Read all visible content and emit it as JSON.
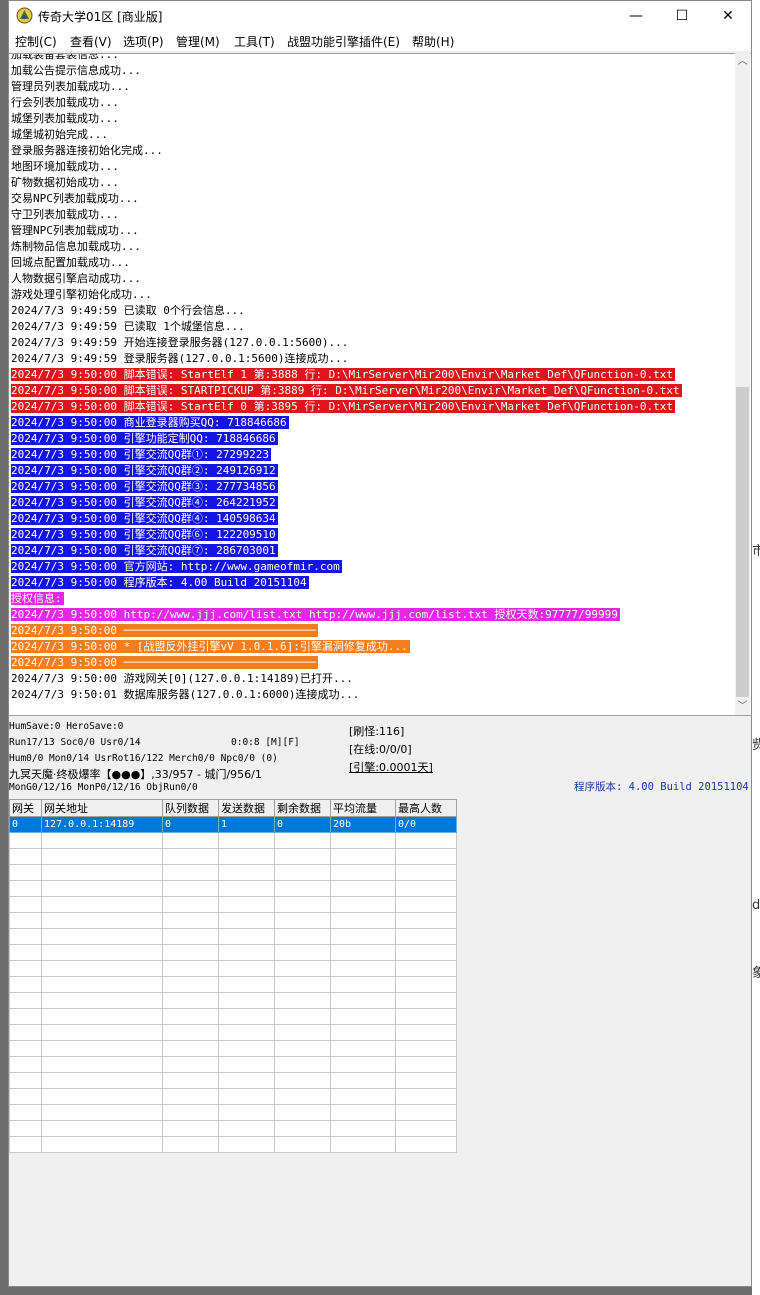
{
  "window": {
    "title": "传奇大学01区 [商业版]",
    "minimize": "—",
    "maximize": "☐",
    "close": "✕"
  },
  "menu": [
    "控制(C)",
    "查看(V)",
    "选项(P)",
    "管理(M)",
    "工具(T)",
    "战盟功能引擎插件(E)",
    "帮助(H)"
  ],
  "background_fragments": [
    "市",
    "赀",
    "d",
    "象"
  ],
  "log": [
    {
      "text": "加载装备套装信息...",
      "style": "plain"
    },
    {
      "text": "加载公告提示信息成功...",
      "style": "plain"
    },
    {
      "text": "管理员列表加载成功...",
      "style": "plain"
    },
    {
      "text": "行会列表加载成功...",
      "style": "plain"
    },
    {
      "text": "城堡列表加载成功...",
      "style": "plain"
    },
    {
      "text": "城堡城初始完成...",
      "style": "plain"
    },
    {
      "text": "登录服务器连接初始化完成...",
      "style": "plain"
    },
    {
      "text": "地图环境加载成功...",
      "style": "plain"
    },
    {
      "text": "矿物数据初始成功...",
      "style": "plain"
    },
    {
      "text": "交易NPC列表加载成功...",
      "style": "plain"
    },
    {
      "text": "守卫列表加载成功...",
      "style": "plain"
    },
    {
      "text": "管理NPC列表加载成功...",
      "style": "plain"
    },
    {
      "text": "炼制物品信息加载成功...",
      "style": "plain"
    },
    {
      "text": "回城点配置加载成功...",
      "style": "plain"
    },
    {
      "text": "人物数据引擎启动成功...",
      "style": "plain"
    },
    {
      "text": "游戏处理引擎初始化成功...",
      "style": "plain"
    },
    {
      "text": "2024/7/3 9:49:59 已读取 0个行会信息...",
      "style": "plain"
    },
    {
      "text": "2024/7/3 9:49:59 已读取 1个城堡信息...",
      "style": "plain"
    },
    {
      "text": "2024/7/3 9:49:59 开始连接登录服务器(127.0.0.1:5600)...",
      "style": "plain"
    },
    {
      "text": "2024/7/3 9:49:59 登录服务器(127.0.0.1:5600)连接成功...",
      "style": "plain"
    },
    {
      "text": "2024/7/3 9:50:00 脚本错误: StartElf 1 第:3888 行: D:\\MirServer\\Mir200\\Envir\\Market_Def\\QFunction-0.txt",
      "style": "red"
    },
    {
      "text": "2024/7/3 9:50:00 脚本错误: STARTPICKUP 第:3889 行: D:\\MirServer\\Mir200\\Envir\\Market_Def\\QFunction-0.txt",
      "style": "red"
    },
    {
      "text": "2024/7/3 9:50:00 脚本错误: StartElf 0 第:3895 行: D:\\MirServer\\Mir200\\Envir\\Market_Def\\QFunction-0.txt",
      "style": "red"
    },
    {
      "text": "2024/7/3 9:50:00 商业登录器购买QQ: 718846686",
      "style": "blue"
    },
    {
      "text": "2024/7/3 9:50:00 引擎功能定制QQ: 718846686",
      "style": "blue"
    },
    {
      "text": "2024/7/3 9:50:00 引擎交流QQ群①: 27299223",
      "style": "blue"
    },
    {
      "text": "2024/7/3 9:50:00 引擎交流QQ群②: 249126912",
      "style": "blue"
    },
    {
      "text": "2024/7/3 9:50:00 引擎交流QQ群③: 277734856",
      "style": "blue"
    },
    {
      "text": "2024/7/3 9:50:00 引擎交流QQ群④: 264221952",
      "style": "blue"
    },
    {
      "text": "2024/7/3 9:50:00 引擎交流QQ群④: 140598634",
      "style": "blue"
    },
    {
      "text": "2024/7/3 9:50:00 引擎交流QQ群⑥: 122209510",
      "style": "blue"
    },
    {
      "text": "2024/7/3 9:50:00 引擎交流QQ群⑦: 286703001",
      "style": "blue"
    },
    {
      "text": "2024/7/3 9:50:00 官方网站: http://www.gameofmir.com",
      "style": "blue"
    },
    {
      "text": "2024/7/3 9:50:00 程序版本: 4.00 Build 20151104",
      "style": "blue"
    },
    {
      "text": "授权信息:",
      "style": "magenta"
    },
    {
      "text": "2024/7/3 9:50:00 http://www.jjj.com/list.txt http://www.jjj.com/list.txt 授权天数:97777/99999",
      "style": "magenta"
    },
    {
      "text": "2024/7/3 9:50:00 ─────────────────────────────",
      "style": "orange"
    },
    {
      "text": "2024/7/3 9:50:00 * [战盟反外挂引擎vV 1.0.1.6]:引擎漏洞修复成功...",
      "style": "orange"
    },
    {
      "text": "2024/7/3 9:50:00 ─────────────────────────────",
      "style": "orange"
    },
    {
      "text": "2024/7/3 9:50:00 游戏网关[0](127.0.0.1:14189)已打开...",
      "style": "plain"
    },
    {
      "text": "2024/7/3 9:50:01 数据库服务器(127.0.0.1:6000)连接成功...",
      "style": "plain"
    }
  ],
  "status": {
    "line1": "HumSave:0 HeroSave:0",
    "line2": "Run17/13 Soc0/0 Usr0/14",
    "line2b": "0:0:8 [M][F]",
    "line3": "Hum0/0 Mon0/14 UsrRot16/122 Merch0/0 Npc0/0 (0)",
    "line4": "九冥天魔·终极爆率【●●●】,33/957 - 城门/956/1",
    "line5": "MonG0/12/16 MonP0/12/16 ObjRun0/0",
    "refresh": "[刷怪:116]",
    "online": "[在线:0/0/0]",
    "engine": "[引擎:0.0001天]",
    "version": "程序版本: 4.00 Build 20151104"
  },
  "gateway_table": {
    "columns": [
      "网关",
      "网关地址",
      "队列数据",
      "发送数据",
      "剩余数据",
      "平均流量",
      "最高人数"
    ],
    "rows": [
      [
        "0",
        "127.0.0.1:14189",
        "0",
        "1",
        "0",
        "20b",
        "0/0"
      ]
    ],
    "empty_rows": 20
  }
}
